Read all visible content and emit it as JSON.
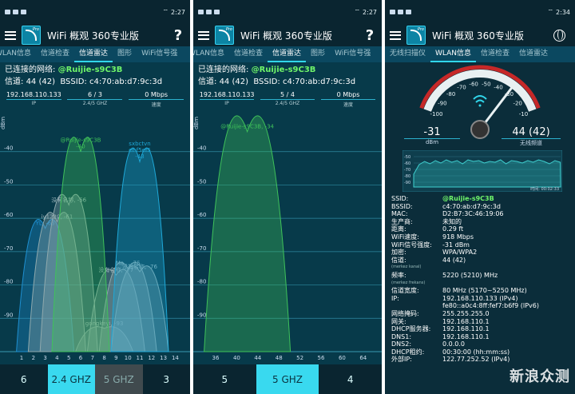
{
  "panels": [
    {
      "status": {
        "time": "2:27",
        "battery": "▮"
      },
      "title": "WiFi 概观 360专业版",
      "tabs": [
        "WLAN信息",
        "信道检查",
        "信道雷达",
        "图形",
        "WiFi信号强"
      ],
      "active_tab": 2,
      "connected_label": "已连接的网络:",
      "ssid": "@Ruijie-s9C3B",
      "channel_label": "信道:",
      "channel_value": "44 (42)",
      "bssid_label": "BSSID:",
      "bssid_value": "c4:70:ab:d7:9c:3d",
      "stats": [
        {
          "value": "192.168.110.133",
          "label": "IP"
        },
        {
          "value": "6 / 3",
          "label": "2.4/5 GHZ"
        },
        {
          "value": "0 Mbps",
          "label": "速度"
        }
      ],
      "bottom": [
        "6",
        "2.4 GHZ",
        "5 GHZ",
        "3"
      ]
    },
    {
      "status": {
        "time": "2:27"
      },
      "title": "WiFi 概观 360专业版",
      "tabs": [
        "WLAN信息",
        "信道检查",
        "信道雷达",
        "图形",
        "WiFi信号强"
      ],
      "active_tab": 2,
      "connected_label": "已连接的网络:",
      "ssid": "@Ruijie-s9C3B",
      "channel_label": "信道:",
      "channel_value": "44 (42)",
      "bssid_label": "BSSID:",
      "bssid_value": "c4:70:ab:d7:9c:3d",
      "stats": [
        {
          "value": "192.168.110.133",
          "label": "IP"
        },
        {
          "value": "5 / 4",
          "label": "2.4/5 GHZ"
        },
        {
          "value": "0 Mbps",
          "label": "速度"
        }
      ],
      "bottom": [
        "5",
        "5 GHZ",
        "4"
      ]
    },
    {
      "status": {
        "time": "2:34"
      },
      "title": "WiFi 概观 360专业版",
      "tabs": [
        "无线扫描仪",
        "WLAN信息",
        "信道检查",
        "信道雷达"
      ],
      "active_tab": 1
    }
  ],
  "chart24": {
    "ylabel": "dBm",
    "yticks": [
      "-40",
      "-50",
      "-60",
      "-70",
      "-80",
      "-90"
    ],
    "xticks": [
      "1",
      "2",
      "3",
      "4",
      "5",
      "6",
      "7",
      "8",
      "9",
      "10",
      "11",
      "12",
      "13",
      "14"
    ],
    "networks": [
      {
        "name": "@Ruijie-s9C3B",
        "dbm": -40,
        "channel": 6,
        "color": "#3fc25a",
        "label": "@Ruijie-s9C3B\n-40"
      },
      {
        "name": "sxbctvn et-f5ef5",
        "dbm": -43,
        "channel": 11,
        "color": "#1ea8d8",
        "label": "sxbctvn\net-f5ef5\n-43"
      },
      {
        "name": "没有名称",
        "dbm": -56,
        "channel": 5,
        "color": "#8fa9ad",
        "label": "没有名称, -56"
      },
      {
        "name": "iy1220",
        "dbm": -61,
        "channel": 4,
        "color": "#8fa9ad",
        "label": "iy1220, -61"
      },
      {
        "name": "YL",
        "dbm": -63,
        "channel": 3,
        "color": "#1e8fd0",
        "label": "YL, -63"
      },
      {
        "name": "Ma...",
        "dbm": -75,
        "channel": 10,
        "color": "#8fa9ad",
        "label": "Ma... -75"
      },
      {
        "name": "没有名称",
        "dbm": -76,
        "channel": 11,
        "color": "#8fa9ad",
        "label": "没有名称, -76"
      },
      {
        "name": "没有名称",
        "dbm": -77,
        "channel": 9,
        "color": "#8fa9ad",
        "label": "没有名称, -77"
      },
      {
        "name": "gongkeyi",
        "dbm": -93,
        "channel": 8,
        "color": "#8fa9ad",
        "label": "gongkeyi, -93"
      }
    ]
  },
  "chart5": {
    "ylabel": "dBm",
    "yticks": [
      "-40",
      "-50",
      "-60",
      "-70",
      "-80",
      "-90"
    ],
    "xticks": [
      "36",
      "40",
      "44",
      "48",
      "52",
      "56",
      "60",
      "64"
    ],
    "networks": [
      {
        "name": "@Ruijie-s9C3B",
        "dbm": -34,
        "channel": 42,
        "color": "#3fc25a",
        "label": "@Ruijie-s9C3B, -34"
      }
    ]
  },
  "gauge": {
    "ticks": [
      "-100",
      "-90",
      "-80",
      "-70",
      "-60",
      "-50",
      "-40",
      "-30",
      "-20",
      "-10"
    ],
    "dbm_value": "-31",
    "dbm_label": "dBm",
    "channel_value": "44 (42)",
    "channel_label": "无线频道",
    "signal": -31,
    "mini_yticks": [
      "-50",
      "-60",
      "-70",
      "-80",
      "-90"
    ],
    "mini_time": "时间: 00:02:33"
  },
  "details": [
    {
      "k": "SSID:",
      "v": "@Ruijie-s9C3B",
      "green": true
    },
    {
      "k": "BSSID:",
      "v": "c4:70:ab:d7:9c:3d"
    },
    {
      "k": "MAC:",
      "v": "D2:B7:3C:46:19:06"
    },
    {
      "k": "生产商:",
      "v": "未知的"
    },
    {
      "k": "距离:",
      "v": "0.29 ft"
    },
    {
      "k": "WiFi速度:",
      "v": "918 Mbps"
    },
    {
      "k": "WiFi信号强度:",
      "v": "-31 dBm"
    },
    {
      "k": "加密:",
      "v": "WPA/WPA2"
    },
    {
      "k": "信道:",
      "v": "44 (42)",
      "sub": "(merkez kanal)"
    },
    {
      "k": "频率:",
      "v": "5220 (5210) MHz",
      "sub": "(merkez frekans)"
    },
    {
      "k": "信道宽度:",
      "v": "80 MHz (5170~5250 MHz)"
    },
    {
      "k": "IP:",
      "v": "192.168.110.133 (IPv4)"
    },
    {
      "k": "",
      "v": "fe80::a0c4:8ff:fef7:b6f9 (IPv6)"
    },
    {
      "k": "网络掩码:",
      "v": "255.255.255.0"
    },
    {
      "k": "网关:",
      "v": "192.168.110.1"
    },
    {
      "k": "DHCP服务器:",
      "v": "192.168.110.1"
    },
    {
      "k": "DNS1:",
      "v": "192.168.110.1"
    },
    {
      "k": "DNS2:",
      "v": "0.0.0.0"
    },
    {
      "k": "DHCP租约:",
      "v": "00:30:00 (hh:mm:ss)"
    },
    {
      "k": "外部IP:",
      "v": "122.77.252.52 (IPv4)"
    }
  ],
  "watermark": "新浪众测"
}
